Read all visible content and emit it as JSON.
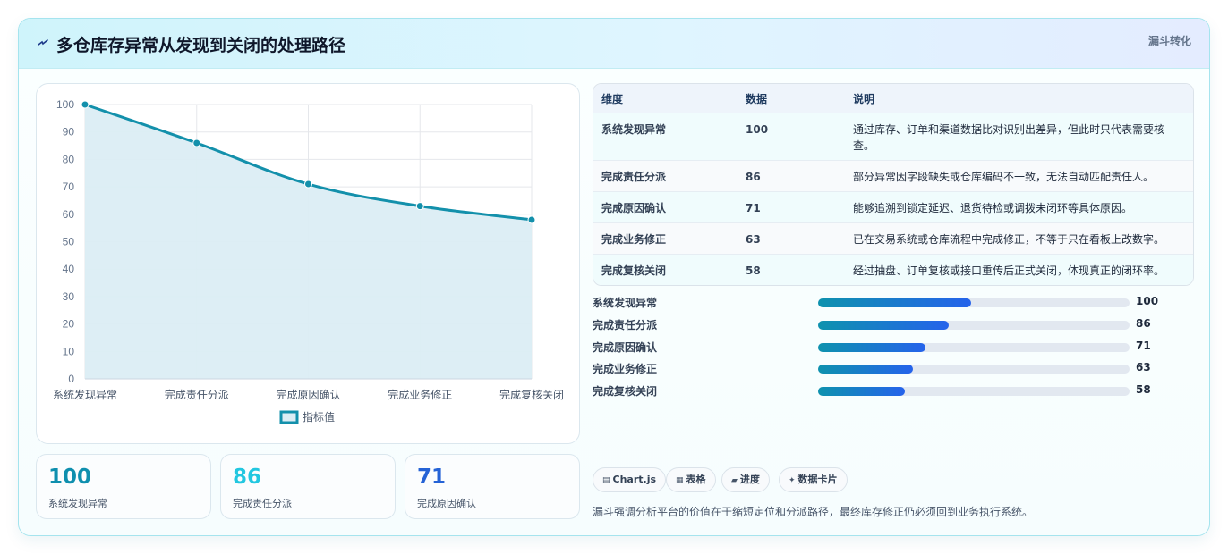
{
  "header": {
    "title": "多仓库存异常从发现到关闭的处理路径",
    "tag": "漏斗转化"
  },
  "chart_data": {
    "type": "line",
    "categories": [
      "系统发现异常",
      "完成责任分派",
      "完成原因确认",
      "完成业务修正",
      "完成复核关闭"
    ],
    "series": [
      {
        "name": "指标值",
        "values": [
          100,
          86,
          71,
          63,
          58
        ]
      }
    ],
    "ylim": [
      0,
      100
    ],
    "yticks": [
      0,
      10,
      20,
      30,
      40,
      50,
      60,
      70,
      80,
      90,
      100
    ],
    "grid": true,
    "area_fill": true,
    "legend": "bottom",
    "colors": {
      "line": "#1390ab",
      "fill": "#dbedf4"
    }
  },
  "stats": [
    {
      "value": "100",
      "label": "系统发现异常",
      "color": "#0e8fae"
    },
    {
      "value": "86",
      "label": "完成责任分派",
      "color": "#22c7e0"
    },
    {
      "value": "71",
      "label": "完成原因确认",
      "color": "#2563d6"
    }
  ],
  "table": {
    "headers": [
      "维度",
      "数据",
      "说明"
    ],
    "rows": [
      [
        "系统发现异常",
        "100",
        "通过库存、订单和渠道数据比对识别出差异，但此时只代表需要核查。"
      ],
      [
        "完成责任分派",
        "86",
        "部分异常因字段缺失或仓库编码不一致，无法自动匹配责任人。"
      ],
      [
        "完成原因确认",
        "71",
        "能够追溯到锁定延迟、退货待检或调拨未闭环等具体原因。"
      ],
      [
        "完成业务修正",
        "63",
        "已在交易系统或仓库流程中完成修正，不等于只在看板上改数字。"
      ],
      [
        "完成复核关闭",
        "58",
        "经过抽盘、订单复核或接口重传后正式关闭，体现真正的闭环率。"
      ]
    ]
  },
  "progress": [
    {
      "label": "系统发现异常",
      "value": "100",
      "fraction": 0.49
    },
    {
      "label": "完成责任分派",
      "value": "86",
      "fraction": 0.42
    },
    {
      "label": "完成原因确认",
      "value": "71",
      "fraction": 0.345
    },
    {
      "label": "完成业务修正",
      "value": "63",
      "fraction": 0.305
    },
    {
      "label": "完成复核关闭",
      "value": "58",
      "fraction": 0.28
    }
  ],
  "chips": [
    {
      "icon": "chart-icon",
      "label": "Chart.js"
    },
    {
      "icon": "table-icon",
      "label": "表格"
    },
    {
      "icon": "progress-icon",
      "label": "进度"
    },
    {
      "icon": "spark-icon",
      "label": "数据卡片"
    }
  ],
  "note": "漏斗强调分析平台的价值在于缩短定位和分派路径，最终库存修正仍必须回到业务执行系统。"
}
